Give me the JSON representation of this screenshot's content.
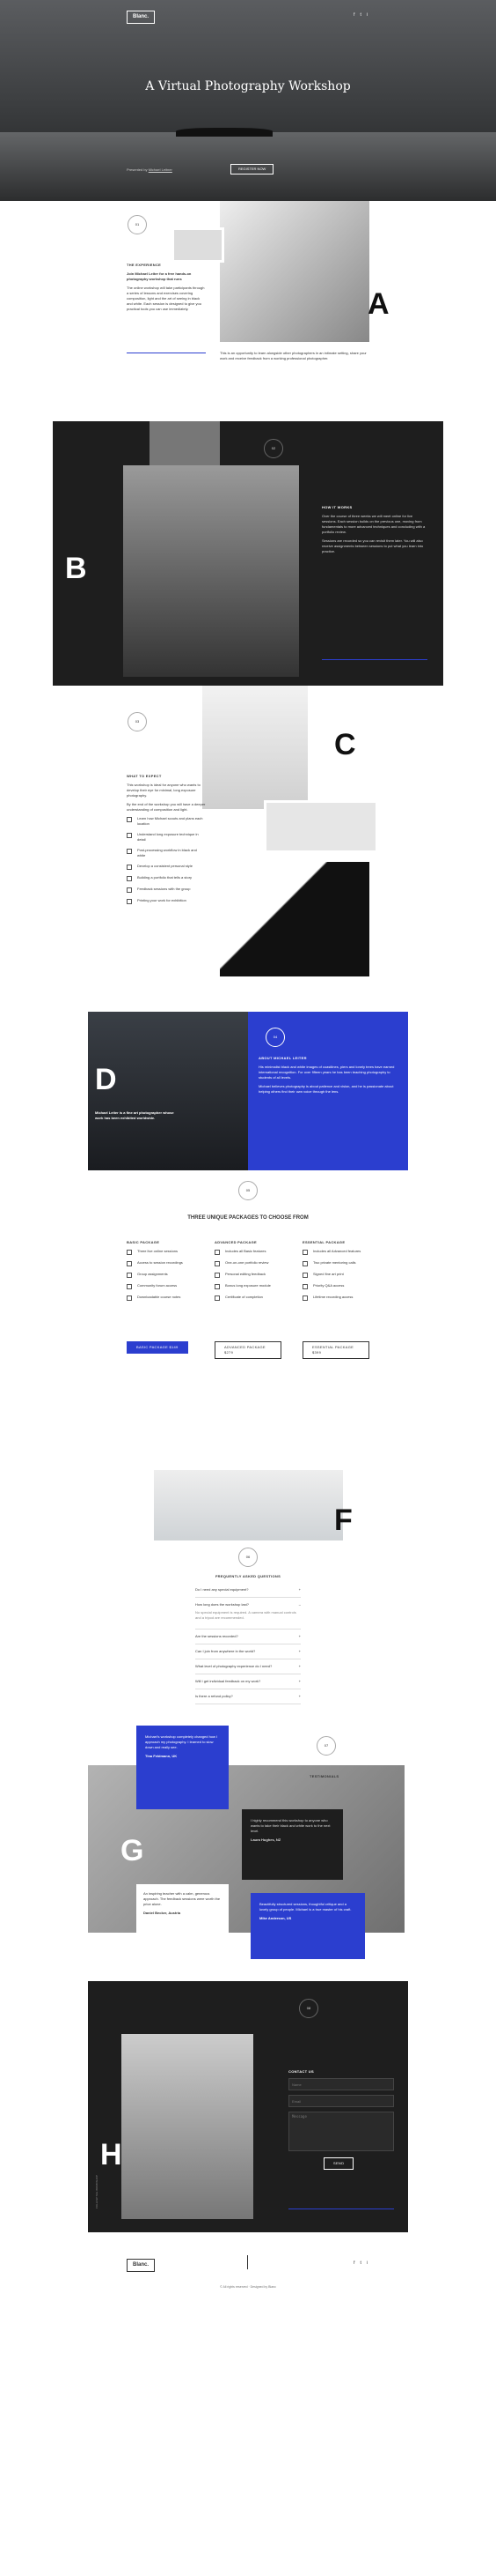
{
  "hero": {
    "logo": "Blanc.",
    "title": "A Virtual Photography Workshop",
    "presented": "Presented by",
    "presenter": "Michael Leitner",
    "cta": "REGISTER NOW",
    "social": [
      "f",
      "t",
      "i"
    ]
  },
  "s1": {
    "num": "01",
    "letter": "A",
    "title": "THE EXPERIENCE",
    "lead": "Join Michael Leiter for a free hands-on photography workshop that runs",
    "body": "The online workshop will take participants through a series of lessons and exercises covering composition, light and the art of seeing in black and white. Each session is designed to give you practical tools you can use immediately.",
    "body2": "This is an opportunity to learn alongside other photographers in an intimate setting, share your work and receive feedback from a working professional photographer."
  },
  "s2": {
    "num": "02",
    "letter": "B",
    "title": "HOW IT WORKS",
    "body": "Over the course of three weeks we will meet online for live sessions. Each session builds on the previous one, moving from fundamentals to more advanced techniques and concluding with a portfolio review.",
    "body2": "Sessions are recorded so you can revisit them later. You will also receive assignments between sessions to put what you learn into practice."
  },
  "s3": {
    "num": "03",
    "letter": "C",
    "title": "WHAT TO EXPECT",
    "body": "This workshop is ideal for anyone who wants to develop their eye for minimal, long exposure photography.",
    "body2": "By the end of the workshop you will have a deeper understanding of composition and light.",
    "items": [
      "Learn how Michael scouts and plans each location",
      "Understand long exposure technique in detail",
      "Post-processing workflow in black and white",
      "Develop a consistent personal style",
      "Building a portfolio that tells a story",
      "Feedback sessions with the group",
      "Printing your work for exhibition"
    ]
  },
  "s4": {
    "num": "04",
    "letter": "D",
    "title": "ABOUT MICHAEL LEITER",
    "quote": "Michael Leiter is a fine art photographer whose work has been exhibited worldwide.",
    "body": "His minimalist black and white images of coastlines, piers and lonely trees have earned international recognition. For over fifteen years he has been teaching photography to students of all levels.",
    "body2": "Michael believes photography is about patience and vision, and he is passionate about helping others find their own voice through the lens."
  },
  "s5": {
    "num": "05",
    "heading": "THREE UNIQUE PACKAGES TO CHOOSE FROM",
    "packages": [
      {
        "title": "BASIC PACKAGE",
        "btn": "BASIC PACKAGE $149",
        "items": [
          "Three live online sessions",
          "Access to session recordings",
          "Group assignments",
          "Community forum access",
          "Downloadable course notes"
        ]
      },
      {
        "title": "ADVANCED PACKAGE",
        "btn": "ADVANCED PACKAGE $279",
        "items": [
          "Includes all Basic features",
          "One-on-one portfolio review",
          "Personal editing feedback",
          "Bonus long exposure module",
          "Certificate of completion"
        ]
      },
      {
        "title": "ESSENTIAL PACKAGE",
        "btn": "ESSENTIAL PACKAGE $399",
        "items": [
          "Includes all Advanced features",
          "Two private mentoring calls",
          "Signed fine art print",
          "Priority Q&A access",
          "Lifetime recording access"
        ]
      }
    ]
  },
  "s6": {
    "letter": "F",
    "num": "06",
    "title": "FREQUENTLY ASKED QUESTIONS",
    "faqs": [
      "Do I need any special equipment?",
      "How long does the workshop last?",
      "Are the sessions recorded?",
      "Can I join from anywhere in the world?",
      "What level of photography experience do I need?",
      "Will I get individual feedback on my work?",
      "Is there a refund policy?"
    ],
    "answer": "No special equipment is required. A camera with manual controls and a tripod are recommended."
  },
  "s7": {
    "letter": "G",
    "num": "07",
    "title": "TESTIMONIALS",
    "t1": "Michael's workshop completely changed how I approach my photography. I learned to slow down and really see.",
    "a1": "Tina Feldmann, UK",
    "t2": "An inspiring teacher with a calm, generous approach. The feedback sessions were worth the price alone.",
    "a2": "Daniel Becker, Austria",
    "t3": "I highly recommend this workshop to anyone who wants to take their black and white work to the next level.",
    "a3": "Laura Hughes, NZ",
    "t4": "Beautifully structured sessions, thoughtful critique and a lovely group of people. Michael is a true master of his craft.",
    "a4": "Mike Anderson, US"
  },
  "s8": {
    "letter": "H",
    "num": "08",
    "title": "CONTACT US",
    "name": "Name",
    "email": "Email",
    "message": "Message",
    "send": "SEND",
    "side": "FOLLOW THE WORKSHOP"
  },
  "footer": {
    "logo": "Blanc.",
    "copy": "© All rights reserved",
    "credit": "Designed by Blanc"
  },
  "colors": {
    "accent": "#2b3ecf",
    "dark": "#1e1e1e"
  }
}
